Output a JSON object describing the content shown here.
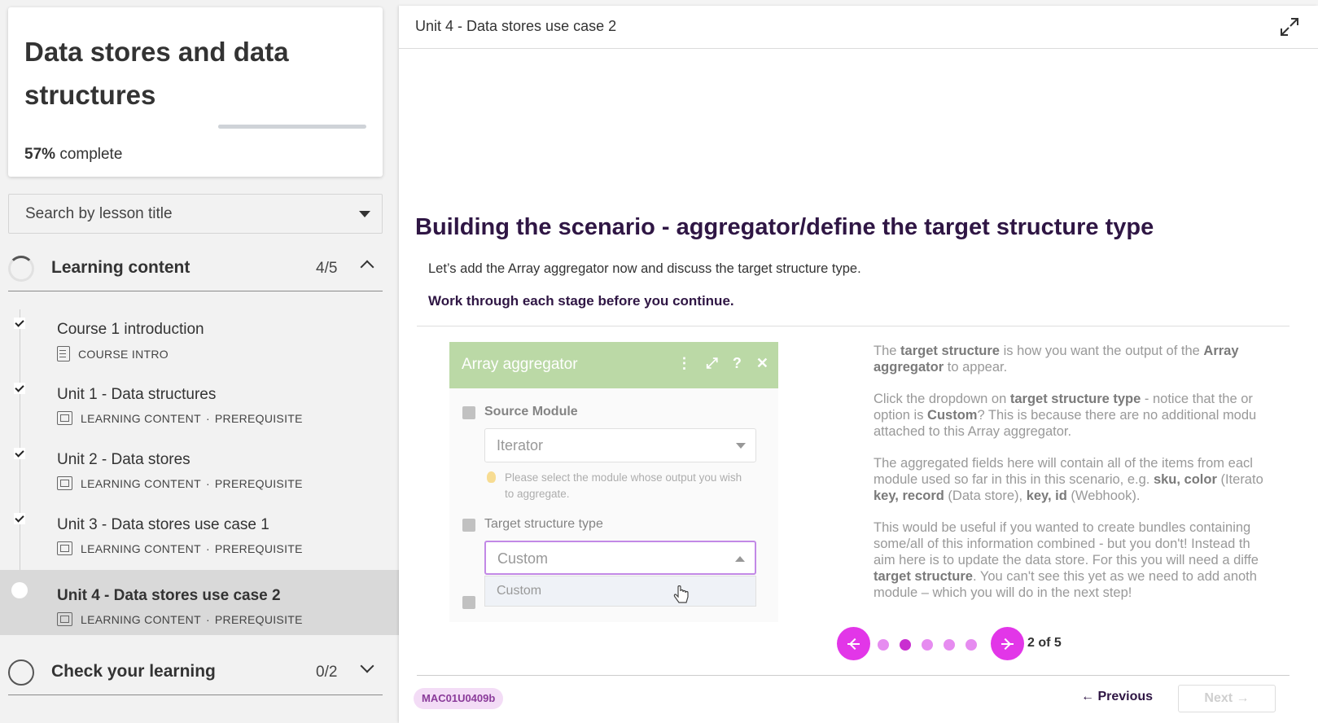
{
  "course": {
    "title": "Data stores and data structures",
    "progress_percent": "57%",
    "progress_suffix": "complete",
    "progress_fraction": 0.57
  },
  "search": {
    "label": "Search by lesson title"
  },
  "sections": [
    {
      "title": "Learning content",
      "count": "4/5",
      "expanded": true
    },
    {
      "title": "Check your learning",
      "count": "0/2",
      "expanded": false
    }
  ],
  "lessons": [
    {
      "name": "Course 1 introduction",
      "type": "COURSE INTRO",
      "tag": "",
      "done": true
    },
    {
      "name": "Unit 1 - Data structures",
      "type": "LEARNING CONTENT",
      "tag": "PREREQUISITE",
      "done": true
    },
    {
      "name": "Unit 2 - Data stores",
      "type": "LEARNING CONTENT",
      "tag": "PREREQUISITE",
      "done": true
    },
    {
      "name": "Unit 3 - Data stores use case 1",
      "type": "LEARNING CONTENT",
      "tag": "PREREQUISITE",
      "done": true
    },
    {
      "name": "Unit 4 - Data stores use case 2",
      "type": "LEARNING CONTENT",
      "tag": "PREREQUISITE",
      "done": false,
      "active": true
    }
  ],
  "meta_separator": "·",
  "main": {
    "unit_title": "Unit 4 - Data stores use case 2",
    "heading": "Building the scenario - aggregator/define the target structure type",
    "intro": "Let’s add the Array aggregator now and discuss the target structure type.",
    "instruction": "Work through each stage before you continue."
  },
  "module_shot": {
    "title": "Array aggregator",
    "icons": [
      "more-vertical-icon",
      "expand-icon",
      "help-icon",
      "close-icon"
    ],
    "source_label": "Source Module",
    "source_value": "Iterator",
    "hint": "Please select the module whose output you wish to aggregate.",
    "target_label": "Target structure type",
    "target_value": "Custom",
    "option": "Custom"
  },
  "explanation": {
    "p1": {
      "a": "The ",
      "b": "target structure",
      "c": " is how you want the output of the ",
      "d": "Array",
      "e": "aggregator",
      "f": " to appear."
    },
    "p2": {
      "a": "Click the dropdown on ",
      "b": "target structure type",
      "c": " - notice that the or",
      "d": "option is ",
      "e": "Custom",
      "f": "? This is because there are no additional modu",
      "g": "attached to this Array aggregator."
    },
    "p3": {
      "a": "The aggregated fields here will contain all of the items from eacl",
      "b": "module used so far in this in this scenario, e.g. ",
      "c": "sku, color",
      "d": " (Iterato",
      "e": "key, record",
      "f": " (Data store), ",
      "g": "key, id",
      "h": " (Webhook)."
    },
    "p4": {
      "a": "This would be useful if you wanted to create bundles containing",
      "b": "some/all of this information combined - but you don't! Instead th",
      "c": "aim here is to update the data store. For this you will need a diffe",
      "d": "target structure",
      "e": ". You can't see this yet as we need to add anoth",
      "f": "module – which you will do in the next step!"
    }
  },
  "carousel": {
    "current": 2,
    "total": 5,
    "label": "2 of 5"
  },
  "footer": {
    "code": "MAC01U0409b",
    "previous": "Previous",
    "next": "Next"
  },
  "colors": {
    "accent": "#e236e8",
    "heading": "#2f1644",
    "module_green": "#8ec06c"
  }
}
